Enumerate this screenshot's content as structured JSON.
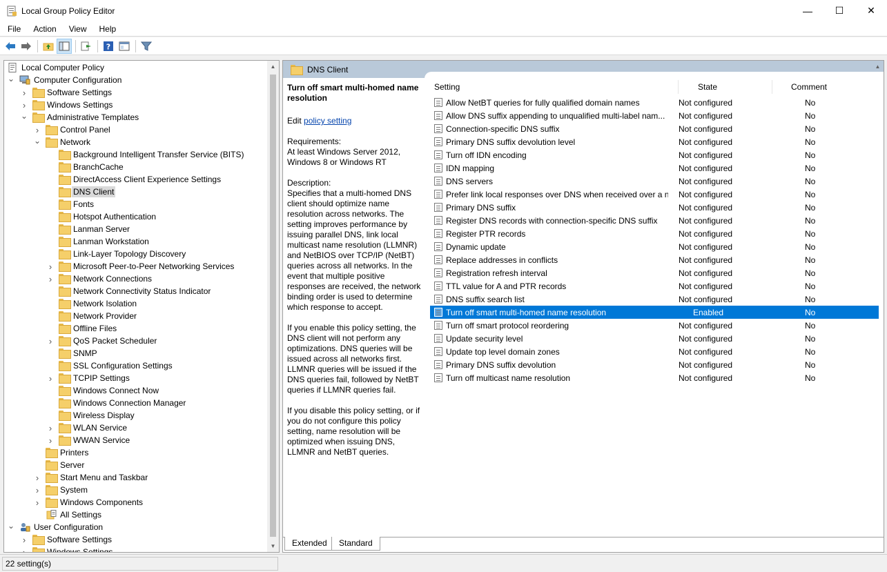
{
  "window": {
    "title": "Local Group Policy Editor",
    "minimize": "—",
    "maximize": "☐",
    "close": "✕"
  },
  "menu": [
    "File",
    "Action",
    "View",
    "Help"
  ],
  "toolbar": [
    "back",
    "forward",
    "up-folder",
    "show-hide-tree",
    "export-list",
    "help",
    "properties-view",
    "filter"
  ],
  "tree": [
    {
      "label": "Local Computer Policy",
      "level": 0,
      "exp": "",
      "icon": "policy-icon"
    },
    {
      "label": "Computer Configuration",
      "level": 0,
      "exp": "v",
      "icon": "computer-icon",
      "indent": 1
    },
    {
      "label": "Software Settings",
      "level": 1,
      "exp": ">",
      "icon": "folder"
    },
    {
      "label": "Windows Settings",
      "level": 1,
      "exp": ">",
      "icon": "folder"
    },
    {
      "label": "Administrative Templates",
      "level": 1,
      "exp": "v",
      "icon": "folder"
    },
    {
      "label": "Control Panel",
      "level": 2,
      "exp": ">",
      "icon": "folder"
    },
    {
      "label": "Network",
      "level": 2,
      "exp": "v",
      "icon": "folder"
    },
    {
      "label": "Background Intelligent Transfer Service (BITS)",
      "level": 3,
      "exp": "",
      "icon": "folder"
    },
    {
      "label": "BranchCache",
      "level": 3,
      "exp": "",
      "icon": "folder"
    },
    {
      "label": "DirectAccess Client Experience Settings",
      "level": 3,
      "exp": "",
      "icon": "folder"
    },
    {
      "label": "DNS Client",
      "level": 3,
      "exp": "",
      "icon": "folder",
      "selected": true
    },
    {
      "label": "Fonts",
      "level": 3,
      "exp": "",
      "icon": "folder"
    },
    {
      "label": "Hotspot Authentication",
      "level": 3,
      "exp": "",
      "icon": "folder"
    },
    {
      "label": "Lanman Server",
      "level": 3,
      "exp": "",
      "icon": "folder"
    },
    {
      "label": "Lanman Workstation",
      "level": 3,
      "exp": "",
      "icon": "folder"
    },
    {
      "label": "Link-Layer Topology Discovery",
      "level": 3,
      "exp": "",
      "icon": "folder"
    },
    {
      "label": "Microsoft Peer-to-Peer Networking Services",
      "level": 3,
      "exp": ">",
      "icon": "folder"
    },
    {
      "label": "Network Connections",
      "level": 3,
      "exp": ">",
      "icon": "folder"
    },
    {
      "label": "Network Connectivity Status Indicator",
      "level": 3,
      "exp": "",
      "icon": "folder"
    },
    {
      "label": "Network Isolation",
      "level": 3,
      "exp": "",
      "icon": "folder"
    },
    {
      "label": "Network Provider",
      "level": 3,
      "exp": "",
      "icon": "folder"
    },
    {
      "label": "Offline Files",
      "level": 3,
      "exp": "",
      "icon": "folder"
    },
    {
      "label": "QoS Packet Scheduler",
      "level": 3,
      "exp": ">",
      "icon": "folder"
    },
    {
      "label": "SNMP",
      "level": 3,
      "exp": "",
      "icon": "folder"
    },
    {
      "label": "SSL Configuration Settings",
      "level": 3,
      "exp": "",
      "icon": "folder"
    },
    {
      "label": "TCPIP Settings",
      "level": 3,
      "exp": ">",
      "icon": "folder"
    },
    {
      "label": "Windows Connect Now",
      "level": 3,
      "exp": "",
      "icon": "folder"
    },
    {
      "label": "Windows Connection Manager",
      "level": 3,
      "exp": "",
      "icon": "folder"
    },
    {
      "label": "Wireless Display",
      "level": 3,
      "exp": "",
      "icon": "folder"
    },
    {
      "label": "WLAN Service",
      "level": 3,
      "exp": ">",
      "icon": "folder"
    },
    {
      "label": "WWAN Service",
      "level": 3,
      "exp": ">",
      "icon": "folder"
    },
    {
      "label": "Printers",
      "level": 2,
      "exp": "",
      "icon": "folder"
    },
    {
      "label": "Server",
      "level": 2,
      "exp": "",
      "icon": "folder"
    },
    {
      "label": "Start Menu and Taskbar",
      "level": 2,
      "exp": ">",
      "icon": "folder"
    },
    {
      "label": "System",
      "level": 2,
      "exp": ">",
      "icon": "folder"
    },
    {
      "label": "Windows Components",
      "level": 2,
      "exp": ">",
      "icon": "folder"
    },
    {
      "label": "All Settings",
      "level": 2,
      "exp": "",
      "icon": "all-settings-icon"
    },
    {
      "label": "User Configuration",
      "level": 0,
      "exp": "v",
      "icon": "user-icon",
      "indent": 1
    },
    {
      "label": "Software Settings",
      "level": 1,
      "exp": ">",
      "icon": "folder"
    },
    {
      "label": "Windows Settings",
      "level": 1,
      "exp": ">",
      "icon": "folder"
    }
  ],
  "right": {
    "header": "DNS Client",
    "desc": {
      "title": "Turn off smart multi-homed name resolution",
      "edit_prefix": "Edit ",
      "edit_link": "policy setting ",
      "requirements": "Requirements:\nAt least Windows Server 2012, Windows 8 or Windows RT",
      "description": "Description:\nSpecifies that a multi-homed DNS client should optimize name resolution across networks.  The setting improves performance by issuing parallel DNS, link local multicast name resolution (LLMNR) and NetBIOS over TCP/IP (NetBT) queries across all networks. In the event that multiple positive responses are received, the network binding order is used to determine which response to accept.",
      "enable": "If you enable this policy setting, the DNS client will not perform any optimizations.  DNS queries will be issued across all networks first. LLMNR queries will be issued if the DNS queries fail, followed by NetBT queries if LLMNR queries fail.",
      "disable": "If you disable this policy setting, or if you do not configure this policy setting, name resolution will be optimized when issuing DNS, LLMNR and NetBT queries."
    },
    "columns": {
      "setting": "Setting",
      "state": "State",
      "comment": "Comment"
    },
    "rows": [
      {
        "setting": "Allow NetBT queries for fully qualified domain names",
        "state": "Not configured",
        "comment": "No"
      },
      {
        "setting": "Allow DNS suffix appending to unqualified multi-label nam...",
        "state": "Not configured",
        "comment": "No"
      },
      {
        "setting": "Connection-specific DNS suffix",
        "state": "Not configured",
        "comment": "No"
      },
      {
        "setting": "Primary DNS suffix devolution level",
        "state": "Not configured",
        "comment": "No"
      },
      {
        "setting": "Turn off IDN encoding",
        "state": "Not configured",
        "comment": "No"
      },
      {
        "setting": "IDN mapping",
        "state": "Not configured",
        "comment": "No"
      },
      {
        "setting": "DNS servers",
        "state": "Not configured",
        "comment": "No"
      },
      {
        "setting": "Prefer link local responses over DNS when received over a n...",
        "state": "Not configured",
        "comment": "No"
      },
      {
        "setting": "Primary DNS suffix",
        "state": "Not configured",
        "comment": "No"
      },
      {
        "setting": "Register DNS records with connection-specific DNS suffix",
        "state": "Not configured",
        "comment": "No"
      },
      {
        "setting": "Register PTR records",
        "state": "Not configured",
        "comment": "No"
      },
      {
        "setting": "Dynamic update",
        "state": "Not configured",
        "comment": "No"
      },
      {
        "setting": "Replace addresses in conflicts",
        "state": "Not configured",
        "comment": "No"
      },
      {
        "setting": "Registration refresh interval",
        "state": "Not configured",
        "comment": "No"
      },
      {
        "setting": "TTL value for A and PTR records",
        "state": "Not configured",
        "comment": "No"
      },
      {
        "setting": "DNS suffix search list",
        "state": "Not configured",
        "comment": "No"
      },
      {
        "setting": "Turn off smart multi-homed name resolution",
        "state": "Enabled",
        "comment": "No",
        "selected": true
      },
      {
        "setting": "Turn off smart protocol reordering",
        "state": "Not configured",
        "comment": "No"
      },
      {
        "setting": "Update security level",
        "state": "Not configured",
        "comment": "No"
      },
      {
        "setting": "Update top level domain zones",
        "state": "Not configured",
        "comment": "No"
      },
      {
        "setting": "Primary DNS suffix devolution",
        "state": "Not configured",
        "comment": "No"
      },
      {
        "setting": "Turn off multicast name resolution",
        "state": "Not configured",
        "comment": "No"
      }
    ],
    "tabs": [
      "Extended",
      "Standard"
    ]
  },
  "status": "22 setting(s)",
  "colors": {
    "selection": "#0078d7",
    "header": "#b9c9d9",
    "link": "#0645ad"
  }
}
